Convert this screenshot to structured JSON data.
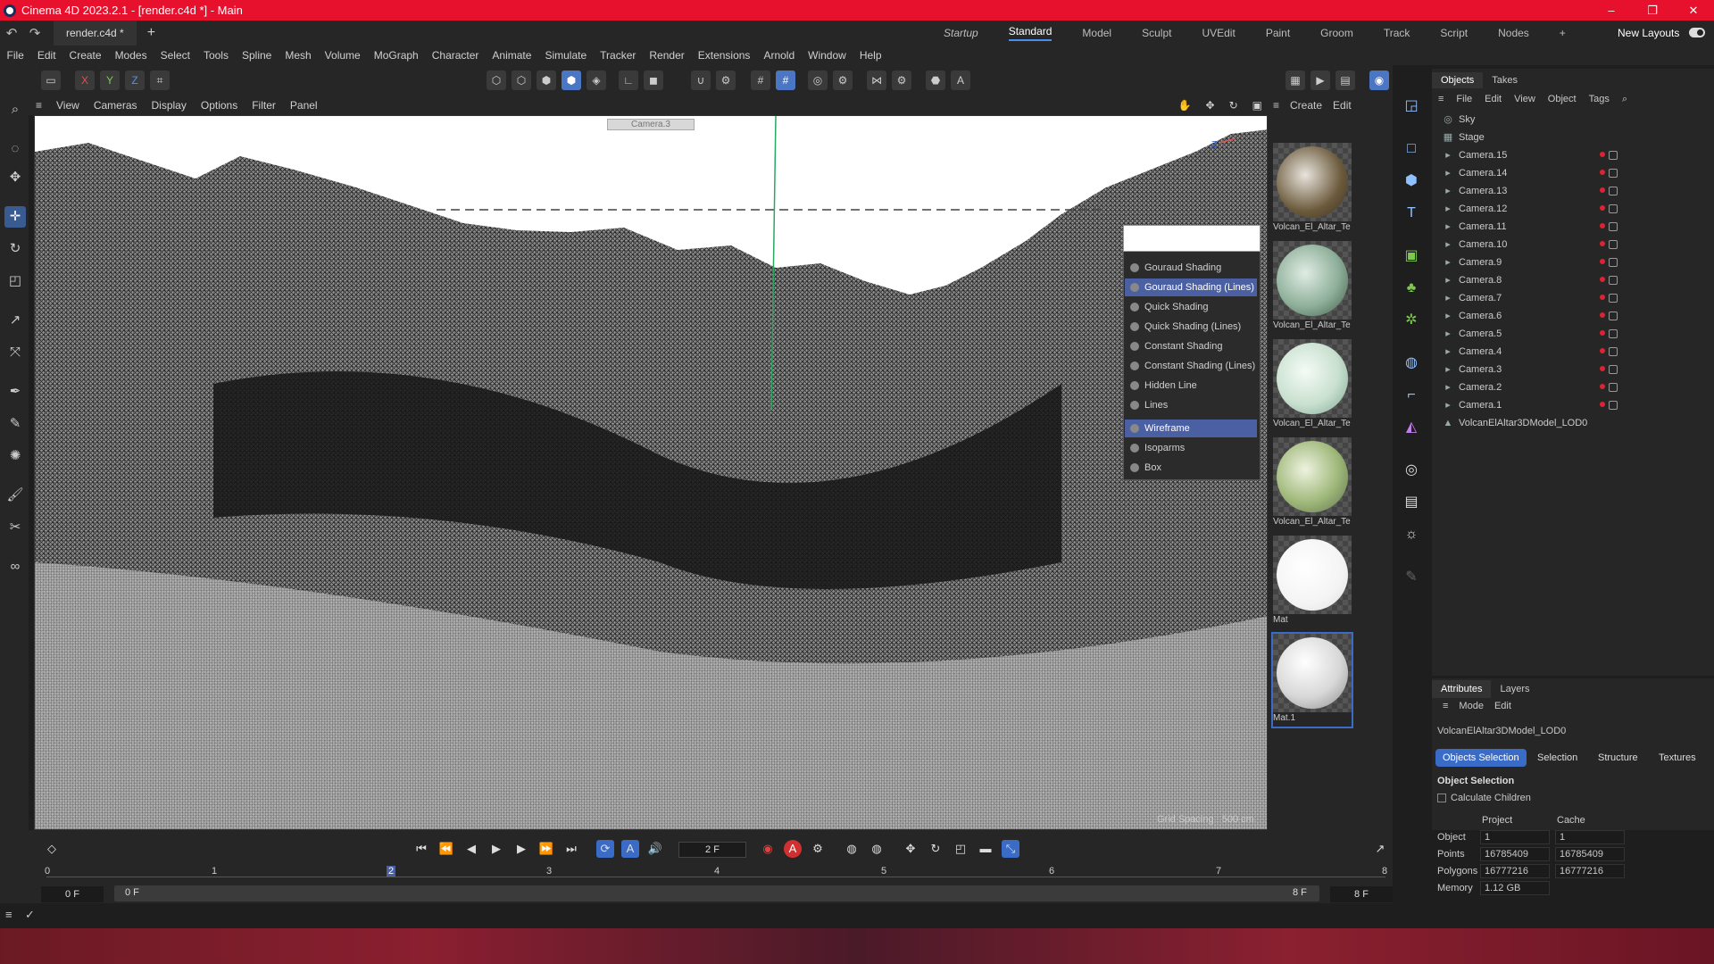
{
  "window": {
    "title": "Cinema 4D 2023.2.1 - [render.c4d *] - Main",
    "min": "–",
    "max": "❐",
    "close": "✕"
  },
  "tabs": {
    "doc": "render.c4d *",
    "plus": "+"
  },
  "layouts": {
    "items": [
      "Startup",
      "Standard",
      "Model",
      "Sculpt",
      "UVEdit",
      "Paint",
      "Groom",
      "Track",
      "Script",
      "Nodes"
    ],
    "plus": "+",
    "new": "New Layouts"
  },
  "menu": [
    "File",
    "Edit",
    "Create",
    "Modes",
    "Select",
    "Tools",
    "Spline",
    "Mesh",
    "Volume",
    "MoGraph",
    "Character",
    "Animate",
    "Simulate",
    "Tracker",
    "Render",
    "Extensions",
    "Arnold",
    "Window",
    "Help"
  ],
  "axes": {
    "x": "X",
    "y": "Y",
    "z": "Z"
  },
  "viewport": {
    "menu": [
      "View",
      "Cameras",
      "Display",
      "Options",
      "Filter",
      "Panel"
    ],
    "camera_label": "Camera.3",
    "grid_spacing": "Grid Spacing : 500 cm",
    "axis_z": "Z"
  },
  "shading_menu": {
    "items": [
      "Gouraud Shading",
      "Gouraud Shading (Lines)",
      "Quick Shading",
      "Quick Shading (Lines)",
      "Constant Shading",
      "Constant Shading (Lines)",
      "Hidden Line",
      "Lines",
      "Wireframe",
      "Isoparms",
      "Box"
    ],
    "highlighted": [
      "Gouraud Shading (Lines)",
      "Wireframe"
    ]
  },
  "materials": {
    "menu": [
      "Create",
      "Edit"
    ],
    "items": [
      {
        "name": "Volcan_El_Altar_Te",
        "color": "#6b5a3c"
      },
      {
        "name": "Volcan_El_Altar_Te",
        "color": "#8fb09a"
      },
      {
        "name": "Volcan_El_Altar_Te",
        "color": "#c9e0cf"
      },
      {
        "name": "Volcan_El_Altar_Te",
        "color": "#9fb87a"
      },
      {
        "name": "Mat",
        "color": "#ffffff"
      },
      {
        "name": "Mat.1",
        "color": "#e8e8e8"
      }
    ]
  },
  "objects": {
    "tabs": [
      "Objects",
      "Takes"
    ],
    "menu": [
      "File",
      "Edit",
      "View",
      "Object",
      "Tags"
    ],
    "rows": [
      "Sky",
      "Stage",
      "Camera.15",
      "Camera.14",
      "Camera.13",
      "Camera.12",
      "Camera.11",
      "Camera.10",
      "Camera.9",
      "Camera.8",
      "Camera.7",
      "Camera.6",
      "Camera.5",
      "Camera.4",
      "Camera.3",
      "Camera.2",
      "Camera.1",
      "VolcanElAltar3DModel_LOD0"
    ]
  },
  "attributes": {
    "tabs": [
      "Attributes",
      "Layers"
    ],
    "menu": [
      "Mode",
      "Edit"
    ],
    "object_name": "VolcanElAltar3DModel_LOD0",
    "pills": [
      "Objects Selection",
      "Selection",
      "Structure",
      "Textures"
    ],
    "section": "Object Selection",
    "calc_children": "Calculate Children",
    "headers": [
      "Project",
      "Cache"
    ],
    "stats": [
      {
        "label": "Object",
        "project": "1",
        "cache": "1"
      },
      {
        "label": "Points",
        "project": "16785409",
        "cache": "16785409"
      },
      {
        "label": "Polygons",
        "project": "16777216",
        "cache": "16777216"
      },
      {
        "label": "Memory",
        "project": "1.12 GB",
        "cache": ""
      }
    ]
  },
  "timeline": {
    "current_frame": "2 F",
    "ruler": [
      "0",
      "1",
      "2",
      "3",
      "4",
      "5",
      "6",
      "7",
      "8"
    ],
    "start": "0 F",
    "range_start": "0 F",
    "range_end": "8 F",
    "end": "8 F"
  }
}
